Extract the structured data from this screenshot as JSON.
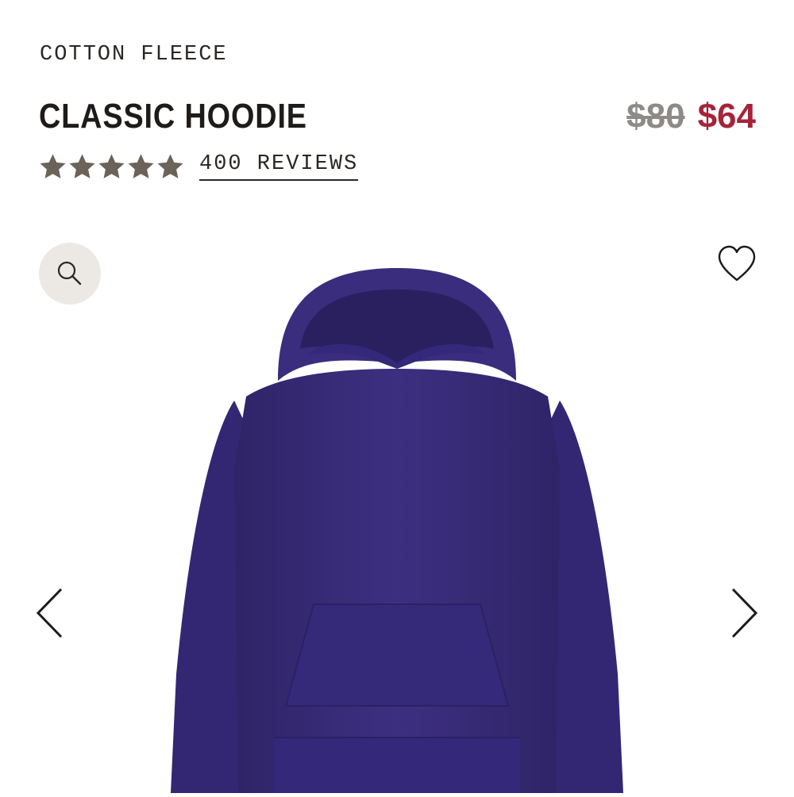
{
  "product": {
    "category": "COTTON FLEECE",
    "name": "CLASSIC HOODIE",
    "price_original": "$80",
    "price_sale": "$64",
    "rating": 5,
    "rating_max": 5,
    "reviews_label": "400 REVIEWS"
  },
  "colors": {
    "text": "#221f1c",
    "sale_price": "#a5243a",
    "original_price": "#8d8a88",
    "star": "#6b6259",
    "zoom_button_bg": "#ece9e4",
    "product": "#3b2e78"
  },
  "icons": {
    "zoom": "search-icon",
    "wishlist": "heart-icon",
    "previous": "chevron-left-icon",
    "next": "chevron-right-icon",
    "rating": "star-icon"
  }
}
